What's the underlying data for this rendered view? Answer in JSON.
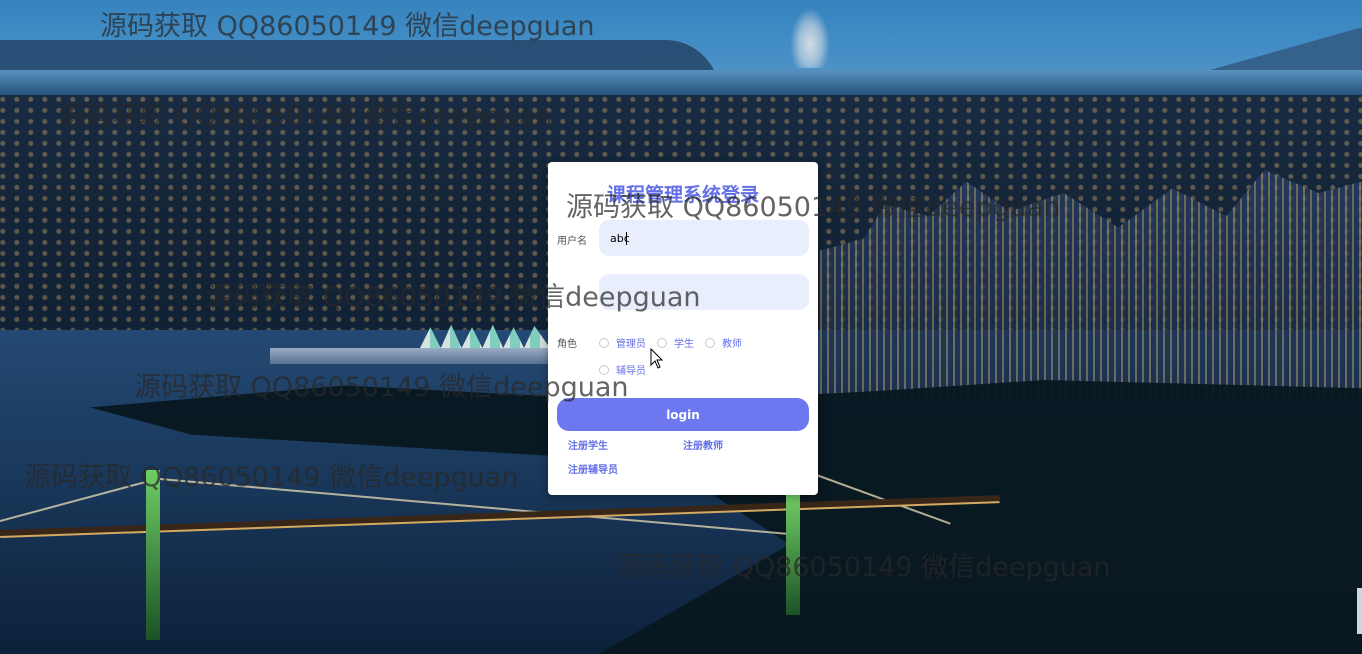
{
  "login": {
    "title": "课程管理系统登录",
    "username_label": "用户名",
    "username_value": "abc",
    "password_value": "",
    "role_label": "角色",
    "roles": [
      "管理员",
      "学生",
      "教师",
      "辅导员"
    ],
    "login_button": "login",
    "register_links": [
      "注册学生",
      "注册教师",
      "注册辅导员"
    ]
  },
  "watermark_text": "源码获取 QQ86050149 微信deepguan",
  "colors": {
    "accent": "#6470e8",
    "button": "#6d78f0",
    "input_bg": "#e8eefb",
    "watermark": "#3a3a3a"
  }
}
